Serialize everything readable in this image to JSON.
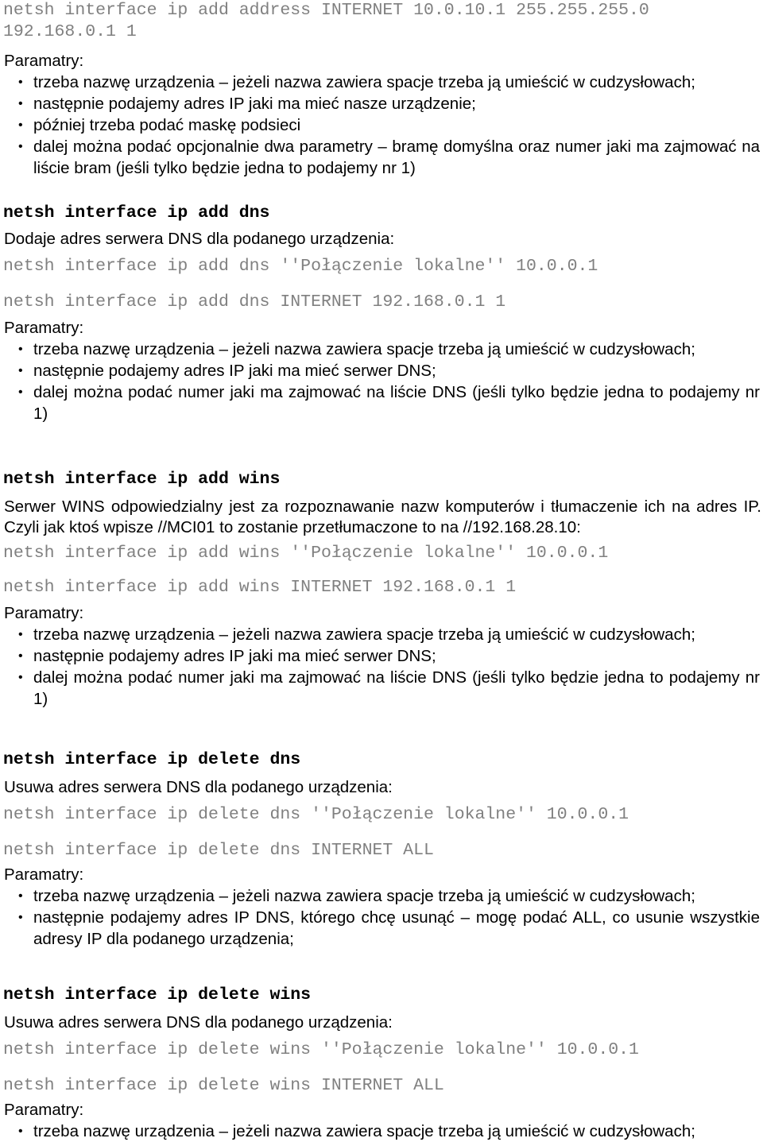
{
  "document": {
    "language": "pl",
    "labels": {
      "params": "Paramatry:",
      "bullet_glyph": "•"
    },
    "colors": {
      "text": "#000000",
      "command": "#808080",
      "background": "#ffffff"
    },
    "bullets_common": {
      "device_name": "trzeba nazwę urządzenia – jeżeli nazwa zawiera spacje trzeba ją umieścić w cudzysłowach;",
      "dns_server_ip": "następnie podajemy adres IP jaki ma mieć serwer DNS;",
      "dns_list_number": "dalej można podać numer jaki ma zajmować na liście DNS (jeśli tylko będzie jedna to podajemy nr 1)"
    },
    "top_command": {
      "line1": "netsh interface ip add address INTERNET 10.0.10.1 255.255.255.0",
      "line2": "192.168.0.1 1"
    },
    "sections": [
      {
        "id": "add-address-params",
        "params_label": "Paramatry:",
        "bullets": [
          "trzeba nazwę urządzenia – jeżeli nazwa zawiera spacje trzeba ją umieścić w cudzysłowach;",
          "następnie podajemy adres IP jaki ma mieć nasze urządzenie;",
          "później trzeba podać maskę podsieci",
          "dalej można podać opcjonalnie dwa parametry – bramę domyślna oraz numer jaki ma zajmować na liście bram (jeśli tylko będzie jedna to podajemy nr 1)"
        ]
      },
      {
        "id": "add-dns",
        "heading": "netsh interface ip add dns",
        "description": "Dodaje adres serwera DNS dla podanego urządzenia:",
        "examples": [
          "netsh interface ip add dns ''Połączenie lokalne'' 10.0.0.1",
          "netsh interface ip add dns INTERNET 192.168.0.1 1"
        ],
        "params_label": "Paramatry:",
        "bullets": [
          "trzeba nazwę urządzenia – jeżeli nazwa zawiera spacje trzeba ją umieścić w cudzysłowach;",
          "następnie podajemy adres IP jaki ma mieć serwer DNS;",
          "dalej można podać numer jaki ma zajmować na liście DNS (jeśli tylko będzie jedna to podajemy nr 1)"
        ]
      },
      {
        "id": "add-wins",
        "heading": "netsh interface ip add wins",
        "description": "Serwer WINS odpowiedzialny jest za rozpoznawanie nazw komputerów i tłumaczenie ich na adres IP. Czyli jak ktoś wpisze //MCI01 to zostanie przetłumaczone to na //192.168.28.10:",
        "examples": [
          "netsh interface ip add wins ''Połączenie lokalne'' 10.0.0.1",
          "netsh interface ip add wins INTERNET 192.168.0.1 1"
        ],
        "params_label": "Paramatry:",
        "bullets": [
          "trzeba nazwę urządzenia – jeżeli nazwa zawiera spacje trzeba ją umieścić w cudzysłowach;",
          "następnie podajemy adres IP jaki ma mieć serwer DNS;",
          "dalej można podać numer jaki ma zajmować na liście DNS (jeśli tylko będzie jedna to podajemy nr 1)"
        ]
      },
      {
        "id": "delete-dns",
        "heading": "netsh interface ip delete dns",
        "description": "Usuwa adres serwera DNS dla podanego urządzenia:",
        "examples": [
          "netsh interface ip delete dns ''Połączenie lokalne'' 10.0.0.1",
          "netsh interface ip delete dns INTERNET ALL"
        ],
        "params_label": "Paramatry:",
        "bullets": [
          "trzeba nazwę urządzenia – jeżeli nazwa zawiera spacje trzeba ją umieścić w cudzysłowach;",
          "następnie podajemy adres IP DNS, którego chcę usunąć – mogę podać ALL, co usunie wszystkie adresy IP dla podanego urządzenia;"
        ]
      },
      {
        "id": "delete-wins",
        "heading": "netsh interface ip delete wins",
        "description": "Usuwa adres serwera DNS dla podanego urządzenia:",
        "examples": [
          "netsh interface ip delete wins ''Połączenie lokalne'' 10.0.0.1",
          "netsh interface ip delete wins INTERNET ALL"
        ],
        "params_label": "Paramatry:",
        "bullets": [
          "trzeba nazwę urządzenia – jeżeli nazwa zawiera spacje trzeba ją umieścić w cudzysłowach;"
        ]
      }
    ]
  }
}
